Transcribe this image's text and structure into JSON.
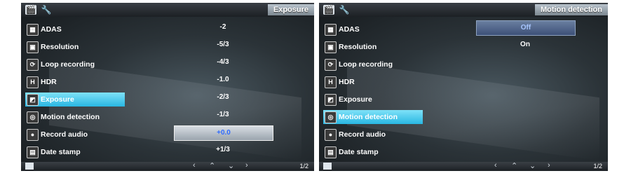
{
  "left": {
    "title": "Exposure",
    "menu": [
      "ADAS",
      "Resolution",
      "Loop recording",
      "HDR",
      "Exposure",
      "Motion detection",
      "Record audio",
      "Date stamp"
    ],
    "selected_index": 4,
    "options": [
      "-2",
      "-5/3",
      "-4/3",
      "-1.0",
      "-2/3",
      "-1/3",
      "+0.0",
      "+1/3"
    ],
    "highlighted_option_index": 6,
    "page": "1/2"
  },
  "right": {
    "title": "Motion detection",
    "menu": [
      "ADAS",
      "Resolution",
      "Loop recording",
      "HDR",
      "Exposure",
      "Motion detection",
      "Record audio",
      "Date stamp"
    ],
    "selected_index": 5,
    "options": [
      "Off",
      "On"
    ],
    "highlighted_option_index": 0,
    "page": "1/2"
  },
  "icons": {
    "tabs": [
      "movie-clapper-icon",
      "wrench-icon"
    ],
    "menu": [
      "adas-icon",
      "resolution-icon",
      "loop-recording-icon",
      "hdr-icon",
      "exposure-icon",
      "motion-detection-icon",
      "microphone-icon",
      "date-stamp-icon"
    ],
    "nav": [
      "arrow-left-icon",
      "arrow-up-icon",
      "arrow-down-icon",
      "arrow-right-icon"
    ]
  }
}
